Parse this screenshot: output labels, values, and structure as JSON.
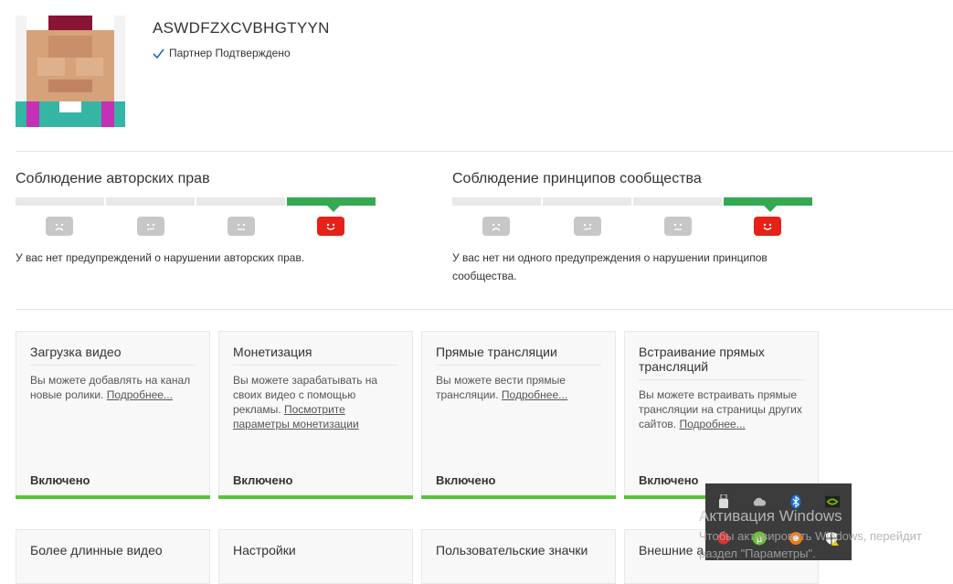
{
  "channel": {
    "name": "ASWDFZXCVBHGTYYN",
    "verified_label": "Партнер Подтверждено"
  },
  "copyright": {
    "title": "Соблюдение авторских прав",
    "message": "У вас нет предупреждений о нарушении авторских прав."
  },
  "community": {
    "title": "Соблюдение принципов сообщества",
    "message": "У вас нет ни одного предупреждения о нарушении принципов сообщества."
  },
  "features": [
    {
      "title": "Загрузка видео",
      "desc": "Вы можете добавлять на канал новые ролики. ",
      "link": "Подробнее...",
      "status": "Включено"
    },
    {
      "title": "Монетизация",
      "desc": "Вы можете зарабатывать на своих видео с помощью рекламы. ",
      "link": "Посмотрите параметры монетизации",
      "status": "Включено"
    },
    {
      "title": "Прямые трансляции",
      "desc": "Вы можете вести прямые трансляции. ",
      "link": "Подробнее...",
      "status": "Включено"
    },
    {
      "title": "Встраивание прямых трансляций",
      "desc": "Вы можете встраивать прямые трансляции на страницы других сайтов. ",
      "link": "Подробнее...",
      "status": "Включено"
    }
  ],
  "features_row2": [
    {
      "title": "Более длинные видео"
    },
    {
      "title": "Настройки"
    },
    {
      "title": "Пользовательские значки"
    },
    {
      "title": "Внешние а"
    }
  ],
  "watermark": {
    "line1": "Активация Windows",
    "line2": "Чтобы активировать Windows, перейдит",
    "line3": "раздел \"Параметры\"."
  },
  "colors": {
    "ok_green": "#34a853",
    "card_bar": "#59c438",
    "active_face": "#e62117",
    "inactive_face": "#c7c7c7"
  }
}
